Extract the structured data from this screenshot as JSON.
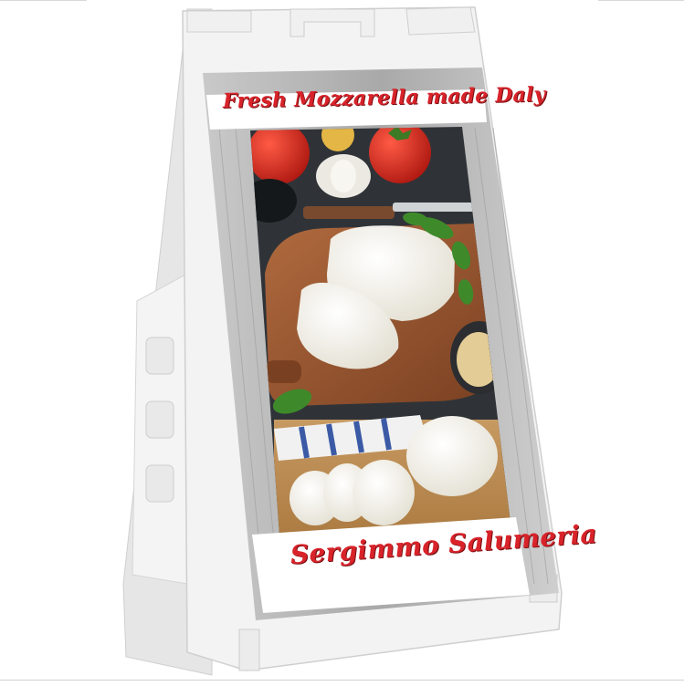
{
  "sign": {
    "headline": "Fresh Mozzarella made Daly",
    "shop_name": "Sergimmo Salumeria"
  },
  "colors": {
    "frame": "#f2f2f2",
    "frame_shadow": "#d2d2d2",
    "accent_red": "#d9232a",
    "wood_grey": "#b9b9b9",
    "cutting_board": "#9b5a34",
    "cheese": "#f6f3ea",
    "basil": "#3e8a2b",
    "tomato": "#d8261d"
  }
}
